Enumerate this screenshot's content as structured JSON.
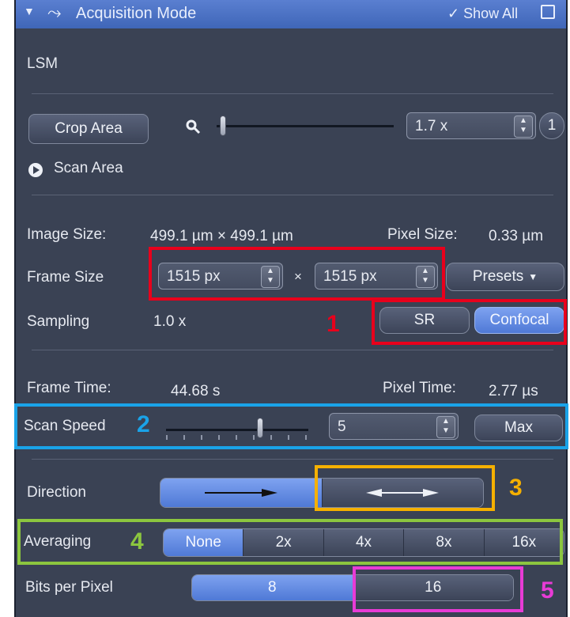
{
  "colors": {
    "panel_bg": "#3a4254",
    "title_bg": "#4a72c6",
    "active_blue": "#5d86e0",
    "box1_red": "#e8001c",
    "box2_cyan": "#1aa3e8",
    "box3_orange": "#f5b000",
    "box4_green": "#8cc63f",
    "box5_magenta": "#e83bd6"
  },
  "titlebar": {
    "title": "Acquisition Mode",
    "show_all": "Show All"
  },
  "lsm_label": "LSM",
  "crop": {
    "button": "Crop Area",
    "zoom_value": "1.7 x",
    "reset": "1",
    "scan_area": "Scan Area"
  },
  "image": {
    "size_label": "Image Size:",
    "size_value": "499.1 µm × 499.1 µm",
    "pixel_size_label": "Pixel Size:",
    "pixel_size_value": "0.33 µm"
  },
  "frame": {
    "label": "Frame Size",
    "width": "1515 px",
    "times": "×",
    "height": "1515 px",
    "presets": "Presets"
  },
  "sampling": {
    "label": "Sampling",
    "value": "1.0 x",
    "options": [
      "SR",
      "Confocal"
    ],
    "selected": "Confocal"
  },
  "timing": {
    "frame_time_label": "Frame Time:",
    "frame_time_value": "44.68 s",
    "pixel_time_label": "Pixel Time:",
    "pixel_time_value": "2.77 µs"
  },
  "scan_speed": {
    "label": "Scan Speed",
    "value": "5",
    "max": "Max",
    "slider_level": 0.67
  },
  "direction": {
    "label": "Direction",
    "options": [
      "unidirectional-arrow",
      "bidirectional-arrow"
    ],
    "selected": "unidirectional-arrow"
  },
  "averaging": {
    "label": "Averaging",
    "options": [
      "None",
      "2x",
      "4x",
      "8x",
      "16x"
    ],
    "selected": "None"
  },
  "bits": {
    "label": "Bits per Pixel",
    "options": [
      "8",
      "16"
    ],
    "selected": "8"
  },
  "annotations": [
    "1",
    "2",
    "3",
    "4",
    "5"
  ]
}
